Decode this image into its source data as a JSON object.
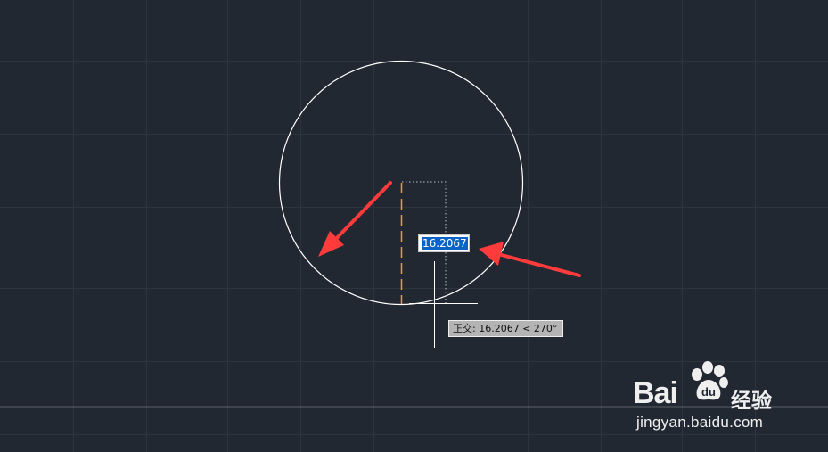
{
  "drawing": {
    "dimension_input": {
      "value": "16.2067"
    },
    "tooltip": {
      "text": "正交: 16.2067 < 270°"
    },
    "colors": {
      "background": "#222832",
      "grid": "#2d3440",
      "entity": "#ffffff",
      "ortho_line": "#e8a020",
      "arrow": "#ff3b3b"
    }
  },
  "watermark": {
    "brand": "Bai",
    "product": "经验",
    "url": "jingyan.baidu.com"
  }
}
